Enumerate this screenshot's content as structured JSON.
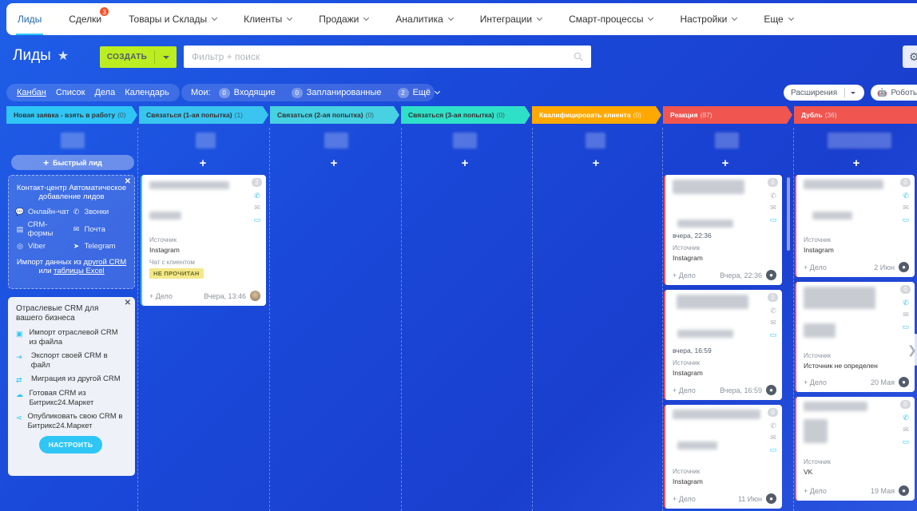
{
  "nav": {
    "items": [
      {
        "label": "Лиды",
        "active": true
      },
      {
        "label": "Сделки",
        "badge": "3"
      },
      {
        "label": "Товары и Склады",
        "dropdown": true
      },
      {
        "label": "Клиенты",
        "dropdown": true
      },
      {
        "label": "Продажи",
        "dropdown": true
      },
      {
        "label": "Аналитика",
        "dropdown": true
      },
      {
        "label": "Интеграции",
        "dropdown": true
      },
      {
        "label": "Смарт-процессы",
        "dropdown": true
      },
      {
        "label": "Настройки",
        "dropdown": true
      },
      {
        "label": "Еще",
        "dropdown": true
      }
    ]
  },
  "header": {
    "title": "Лиды",
    "create_label": "СОЗДАТЬ",
    "filter_placeholder": "Фильтр + поиск"
  },
  "views": [
    "Канбан",
    "Список",
    "Дела",
    "Календарь"
  ],
  "mine": {
    "label": "Мои:",
    "incoming_count": "0",
    "incoming_label": "Входящие",
    "planned_count": "0",
    "planned_label": "Запланированные",
    "more_count": "2",
    "more_label": "Ещё"
  },
  "toolbar": {
    "extensions_label": "Расширения",
    "robots_label": "Роботы"
  },
  "stages": [
    {
      "name": "Новая заявка - взять в работу",
      "count": "(0)",
      "color": "#2fc6f6"
    },
    {
      "name": "Связаться (1-ая попытка)",
      "count": "(1)",
      "color": "#39c5f0"
    },
    {
      "name": "Связаться (2-ая попытка)",
      "count": "(0)",
      "color": "#47d1e2"
    },
    {
      "name": "Связаться (3-ая попытка)",
      "count": "(0)",
      "color": "#2fe0c8"
    },
    {
      "name": "Квалифицировать клиента",
      "count": "(0)",
      "color": "#ffa900"
    },
    {
      "name": "Реакция",
      "count": "(87)",
      "color": "#f0554f"
    },
    {
      "name": "Дубль",
      "count": "(36)",
      "color": "#f0554f"
    }
  ],
  "quick_lead_label": "Быстрый лид",
  "contact_center": {
    "title": "Контакт-центр Автоматическое добавление лидов",
    "items": [
      "Онлайн-чат",
      "Звонки",
      "CRM-формы",
      "Почта",
      "Viber",
      "Telegram"
    ],
    "import_prefix": "Импорт данных из",
    "import_link1": "другой CRM",
    "import_mid": "или",
    "import_link2": "таблицы Excel"
  },
  "industry": {
    "title": "Отраслевые CRM для вашего бизнеса",
    "items": [
      "Импорт отраслевой CRM из файла",
      "Экспорт своей CRM в файл",
      "Миграция из другой CRM",
      "Готовая CRM из Битрикс24.Маркет",
      "Опубликовать свою CRM в Битрикс24.Маркет"
    ],
    "button": "НАСТРОИТЬ"
  },
  "cards": {
    "c1": {
      "count": "2",
      "source_label": "Источник",
      "source": "Instagram",
      "chat_label": "Чат с клиентом",
      "tag": "НЕ ПРОЧИТАН",
      "add": "+ Дело",
      "date": "Вчера, 13:46"
    },
    "r1": {
      "count": "0",
      "date_top": "вчера, 22:36",
      "source_label": "Источник",
      "source": "Instagram",
      "add": "+ Дело",
      "date": "Вчера, 22:36"
    },
    "r2": {
      "count": "0",
      "date_top": "вчера, 16:59",
      "source_label": "Источник",
      "source": "Instagram",
      "add": "+ Дело",
      "date": "Вчера, 16:59"
    },
    "r3": {
      "count": "0",
      "source_label": "Источник",
      "source": "Instagram",
      "add": "+ Дело",
      "date": "11 Июн"
    },
    "d1": {
      "count": "0",
      "source_label": "Источник",
      "source": "Instagram",
      "add": "+ Дело",
      "date": "2 Июн"
    },
    "d2": {
      "count": "0",
      "source_label": "Источник",
      "source": "Источник не определен",
      "add": "+ Дело",
      "date": "20 Мая"
    },
    "d3": {
      "count": "0",
      "source_label": "Источник",
      "source": "VK",
      "add": "+ Дело",
      "date": "19 Мая"
    }
  }
}
